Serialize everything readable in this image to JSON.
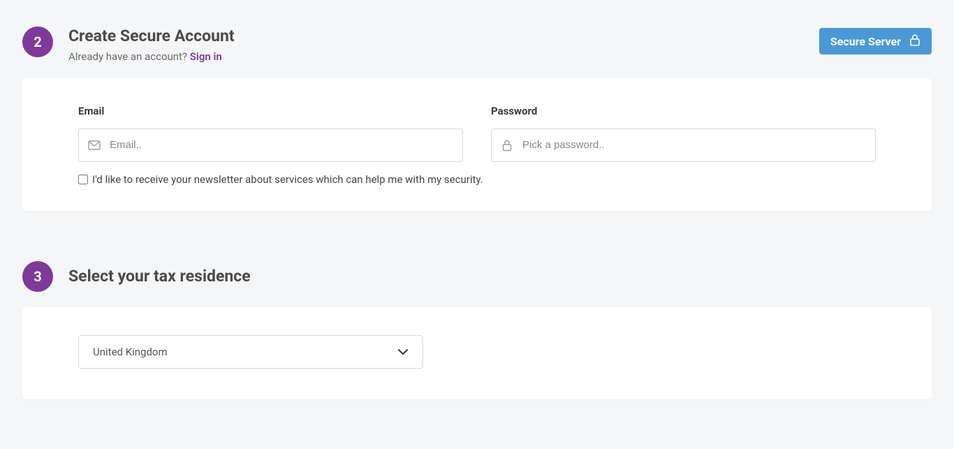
{
  "step2": {
    "number": "2",
    "title": "Create Secure Account",
    "subtitle_prefix": "Already have an account? ",
    "sign_in": "Sign in",
    "secure_badge": "Secure Server",
    "email_label": "Email",
    "email_placeholder": "Email..",
    "password_label": "Password",
    "password_placeholder": "Pick a password..",
    "newsletter_label": "I'd like to receive your newsletter about services which can help me with my security."
  },
  "step3": {
    "number": "3",
    "title": "Select your tax residence",
    "selected_country": "United Kingdom"
  }
}
